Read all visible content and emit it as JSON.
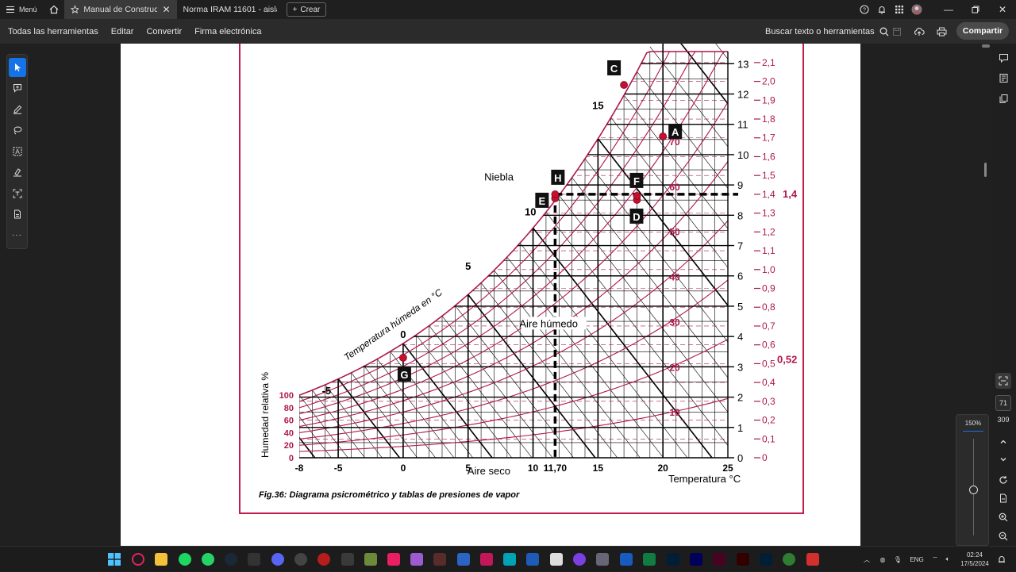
{
  "titlebar": {
    "menu_label": "Menú",
    "tabs": [
      {
        "label": "Manual de Construc...",
        "active": true
      },
      {
        "label": "Norma IRAM 11601 - aislam...",
        "active": false
      }
    ],
    "new_label": "Crear"
  },
  "toolbar": {
    "items": [
      "Todas las herramientas",
      "Editar",
      "Convertir",
      "Firma electrónica"
    ],
    "search_label": "Buscar texto o herramientas",
    "share_label": "Compartir"
  },
  "chart_data": {
    "type": "line",
    "title": "",
    "caption": "Fig.36: Diagrama psicrométrico y tablas de presiones de vapor",
    "xlabel": "Temperatura °C",
    "x_ticks": [
      "-8",
      "-5",
      "0",
      "5",
      "10",
      "11,70",
      "15",
      "20",
      "25"
    ],
    "xlim": [
      -8,
      25
    ],
    "ylabel_left": "Humedad relativa %",
    "rh_ticks": [
      "100",
      "80",
      "60",
      "40",
      "20",
      "0"
    ],
    "y_right1_ticks": [
      "0",
      "1",
      "2",
      "3",
      "4",
      "5",
      "6",
      "7",
      "8",
      "9",
      "10",
      "11",
      "12",
      "13"
    ],
    "y_right2_ticks": [
      "0",
      "0,1",
      "0,2",
      "0,3",
      "0,4",
      "0,5",
      "0,6",
      "0,7",
      "0,8",
      "0,9",
      "1,0",
      "1,1",
      "1,2",
      "1,3",
      "1,4",
      "1,5",
      "1,6",
      "1,7",
      "1,8",
      "1,9",
      "2,0",
      "2,1"
    ],
    "ylim_right1": [
      0,
      13.4
    ],
    "ylim_right2": [
      0,
      2.15
    ],
    "highlighted_values": [
      "1,4",
      "0,52"
    ],
    "rh_curve_labels": [
      "10",
      "20",
      "30",
      "40",
      "50",
      "60",
      "70"
    ],
    "wet_bulb_label": "Temperatura húmeda en °C",
    "wet_bulb_ticks": [
      "-5",
      "0",
      "5",
      "10",
      "15"
    ],
    "region_labels": {
      "fog": "Niebla",
      "humid": "Aire húmedo",
      "dry": "Aire seco"
    },
    "points": [
      {
        "name": "A",
        "x": 20,
        "y": 10.6
      },
      {
        "name": "C",
        "x": 17,
        "y": 12.3
      },
      {
        "name": "D",
        "x": 18,
        "y": 8.8
      },
      {
        "name": "E",
        "x": 11.7,
        "y": 8.8
      },
      {
        "name": "F",
        "x": 18,
        "y": 9.0
      },
      {
        "name": "G",
        "x": 0,
        "y": 3.3
      },
      {
        "name": "H",
        "x": 11.7,
        "y": 9.0
      }
    ],
    "reference_lines": {
      "vapor_pressure_kpa": 1.4,
      "temperature_c": 11.7
    },
    "colors": {
      "curve": "#b0174f",
      "grid": "#000000",
      "frame": "#c41a4c"
    }
  },
  "right_panel": {
    "page_current": "71",
    "page_total": "309",
    "zoom": "150%"
  },
  "taskbar": {
    "language": "ENG",
    "time": "02:24",
    "date": "17/5/2024"
  }
}
